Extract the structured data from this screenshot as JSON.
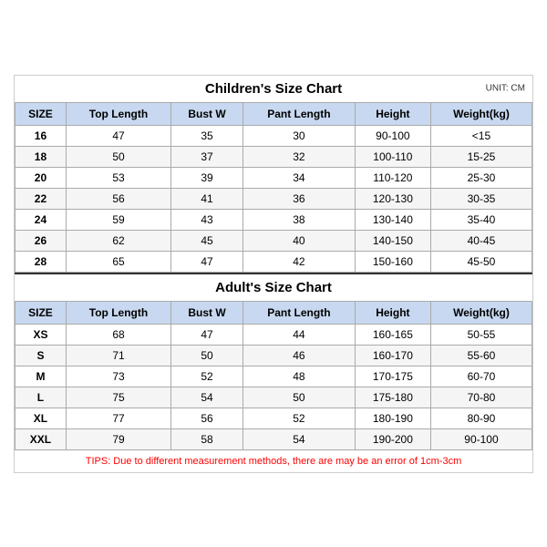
{
  "children_title": "Children's Size Chart",
  "adults_title": "Adult's Size Chart",
  "unit": "UNIT: CM",
  "tips": "TIPS: Due to different measurement methods, there are may be an error of 1cm-3cm",
  "headers": [
    "SIZE",
    "Top Length",
    "Bust W",
    "Pant Length",
    "Height",
    "Weight(kg)"
  ],
  "children_rows": [
    [
      "16",
      "47",
      "35",
      "30",
      "90-100",
      "<15"
    ],
    [
      "18",
      "50",
      "37",
      "32",
      "100-110",
      "15-25"
    ],
    [
      "20",
      "53",
      "39",
      "34",
      "110-120",
      "25-30"
    ],
    [
      "22",
      "56",
      "41",
      "36",
      "120-130",
      "30-35"
    ],
    [
      "24",
      "59",
      "43",
      "38",
      "130-140",
      "35-40"
    ],
    [
      "26",
      "62",
      "45",
      "40",
      "140-150",
      "40-45"
    ],
    [
      "28",
      "65",
      "47",
      "42",
      "150-160",
      "45-50"
    ]
  ],
  "adult_rows": [
    [
      "XS",
      "68",
      "47",
      "44",
      "160-165",
      "50-55"
    ],
    [
      "S",
      "71",
      "50",
      "46",
      "160-170",
      "55-60"
    ],
    [
      "M",
      "73",
      "52",
      "48",
      "170-175",
      "60-70"
    ],
    [
      "L",
      "75",
      "54",
      "50",
      "175-180",
      "70-80"
    ],
    [
      "XL",
      "77",
      "56",
      "52",
      "180-190",
      "80-90"
    ],
    [
      "XXL",
      "79",
      "58",
      "54",
      "190-200",
      "90-100"
    ]
  ]
}
